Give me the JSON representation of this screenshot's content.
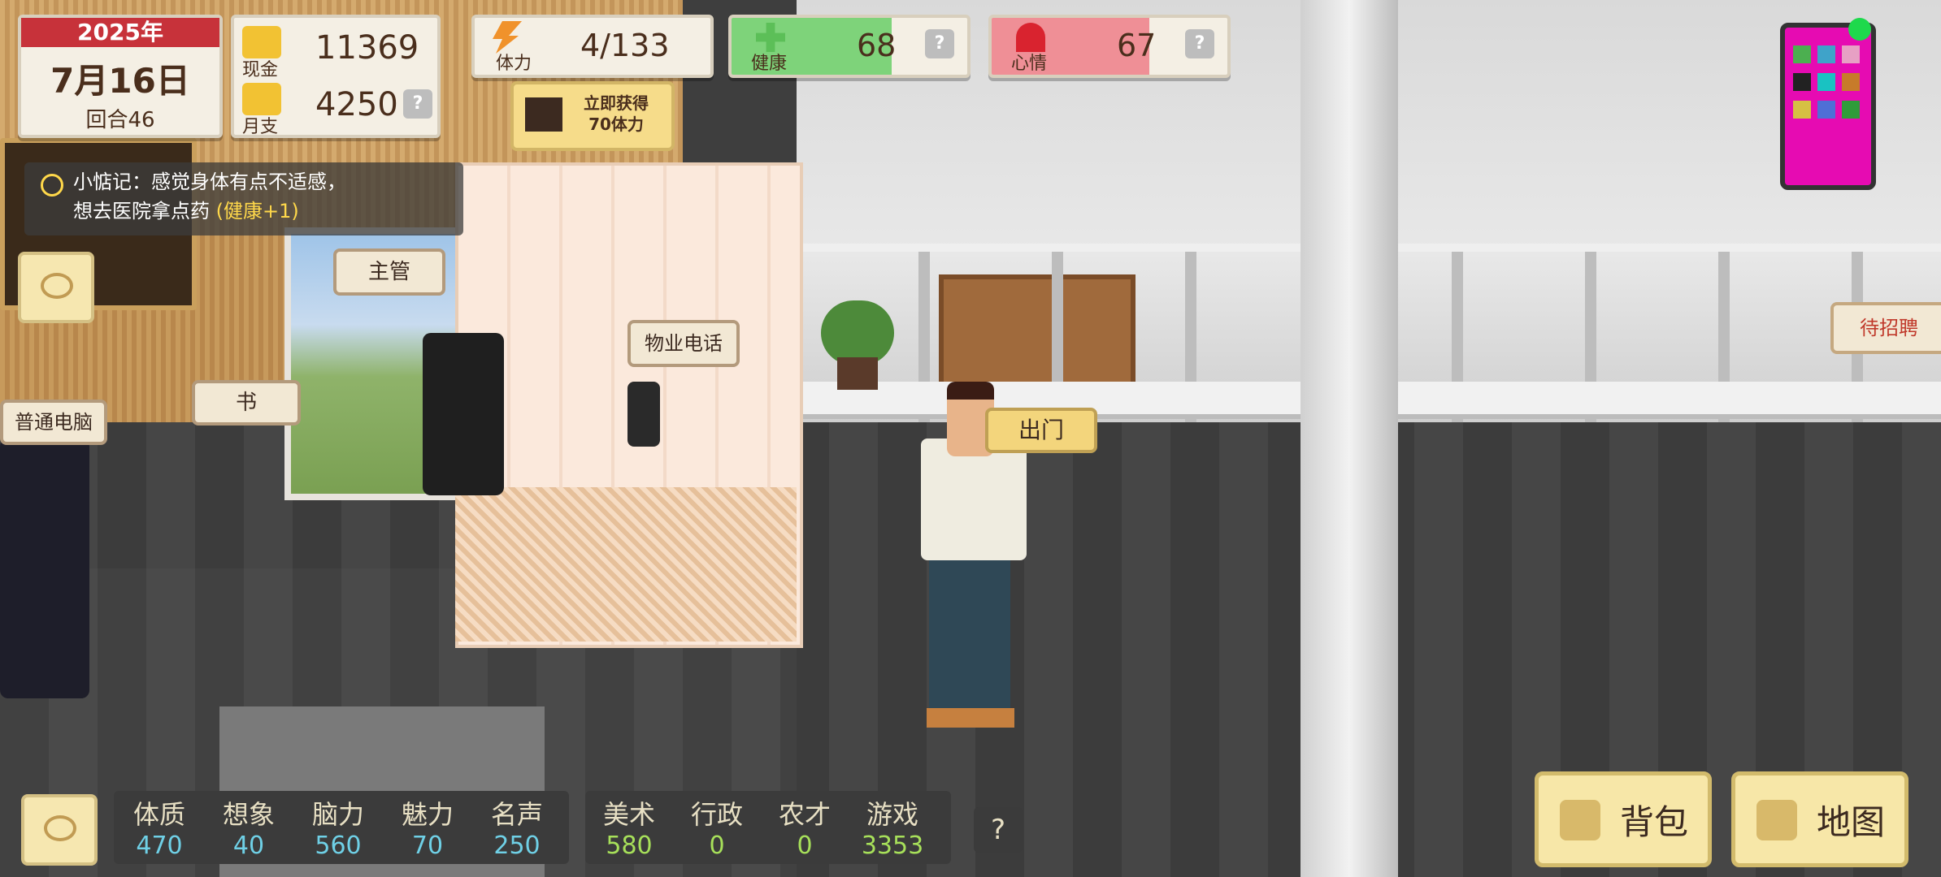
{
  "date": {
    "year": "2025年",
    "day": "7月16日",
    "round": "回合46"
  },
  "money": {
    "cash_label": "现金",
    "cash_value": "11369",
    "monthly_label": "月支",
    "monthly_value": "4250",
    "help": "?"
  },
  "stamina": {
    "label": "体力",
    "value": "4/133"
  },
  "ad_button": {
    "line1": "立即获得",
    "line2": "70体力"
  },
  "health": {
    "label": "健康",
    "value": "68",
    "fill_percent": 68,
    "color": "#7ed37a",
    "help": "?"
  },
  "mood": {
    "label": "心情",
    "value": "67",
    "fill_percent": 67,
    "color": "#ef8f96",
    "help": "?"
  },
  "note": {
    "prefix": "小惦记：感觉身体有点不适感，",
    "line2": "想去医院拿点药",
    "highlight": "(健康+1)"
  },
  "bubbles": {
    "supervisor": "主管",
    "book": "书",
    "computer": "普通电脑",
    "property_phone": "物业电话",
    "go_out": "出门",
    "hiring": "待招聘"
  },
  "stats": [
    {
      "label": "体质",
      "value": "470"
    },
    {
      "label": "想象",
      "value": "40"
    },
    {
      "label": "脑力",
      "value": "560"
    },
    {
      "label": "魅力",
      "value": "70"
    },
    {
      "label": "名声",
      "value": "250"
    }
  ],
  "skills": [
    {
      "label": "美术",
      "value": "580"
    },
    {
      "label": "行政",
      "value": "0"
    },
    {
      "label": "农才",
      "value": "0"
    },
    {
      "label": "游戏",
      "value": "3353"
    }
  ],
  "stats_help": "?",
  "buttons": {
    "backpack": "背包",
    "map": "地图"
  },
  "icons": [
    "gold-coin-icon",
    "lightning-icon",
    "film-icon",
    "health-cross-icon",
    "heart-icon",
    "eye-icon",
    "backpack-icon",
    "map-flag-icon",
    "smartphone-icon"
  ],
  "colors": {
    "year_banner": "#c7323a",
    "stat_value": "#6fd0e6",
    "skill_value": "#a7e05a",
    "hiring_text": "#c0392b",
    "phone_body": "#e60bb2",
    "online_dot": "#1ed94c"
  }
}
